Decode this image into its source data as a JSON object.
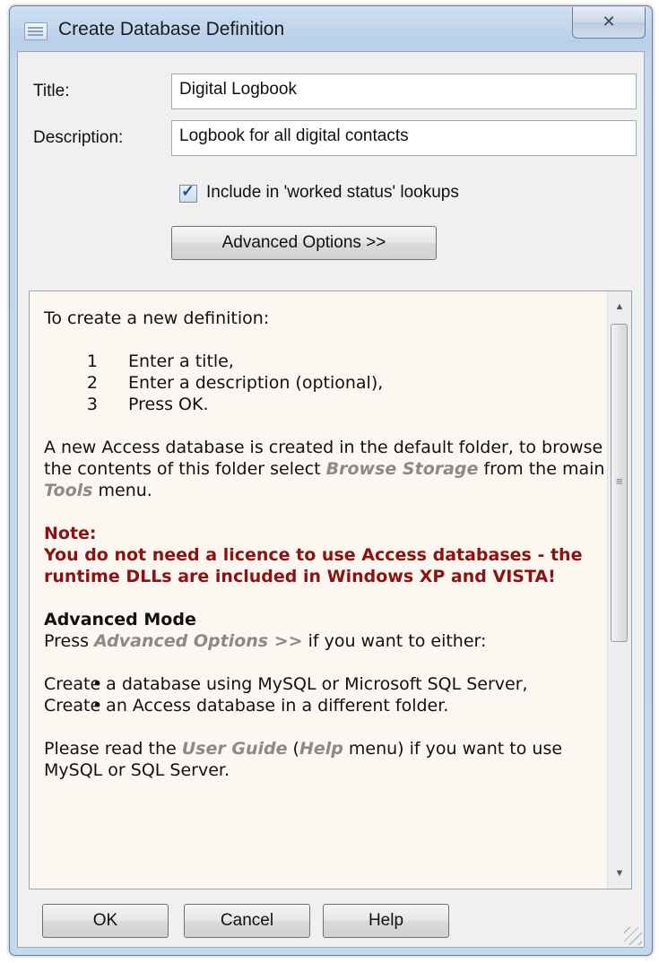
{
  "window": {
    "title": "Create Database Definition",
    "close_label": "✕"
  },
  "form": {
    "title_label": "Title:",
    "title_value": "Digital Logbook",
    "description_label": "Description:",
    "description_value": "Logbook for all digital contacts",
    "include_label": "Include in 'worked status' lookups",
    "include_checked": true,
    "advanced_button": "Advanced Options >>"
  },
  "info": {
    "intro": "To create a new definition:",
    "steps": [
      {
        "num": "1",
        "text": "Enter a title,"
      },
      {
        "num": "2",
        "text": "Enter a description (optional),"
      },
      {
        "num": "3",
        "text": "Press OK."
      }
    ],
    "para1_a": "A new Access database is created in the default folder, to browse the contents of this folder select ",
    "para1_link1": "Browse Storage",
    "para1_b": " from the main ",
    "para1_link2": "Tools",
    "para1_c": " menu.",
    "note_title": "Note:",
    "note_body": "You do not need a licence to use Access databases - the runtime DLLs are included in Windows XP and VISTA!",
    "adv_title": "Advanced Mode",
    "adv_a": "Press ",
    "adv_link": "Advanced Options >>",
    "adv_b": " if you want to either:",
    "bullets": [
      "Create a database using MySQL or Microsoft SQL Server,",
      "Create an Access database in a different folder."
    ],
    "para3_a": "Please read the ",
    "para3_link1": "User Guide",
    "para3_b": " (",
    "para3_link2": "Help",
    "para3_c": " menu) if you want to use MySQL or SQL Server."
  },
  "buttons": {
    "ok": "OK",
    "cancel": "Cancel",
    "help": "Help"
  },
  "scroll": {
    "up_icon": "▲",
    "down_icon": "▼",
    "grip_icon": "≡"
  }
}
